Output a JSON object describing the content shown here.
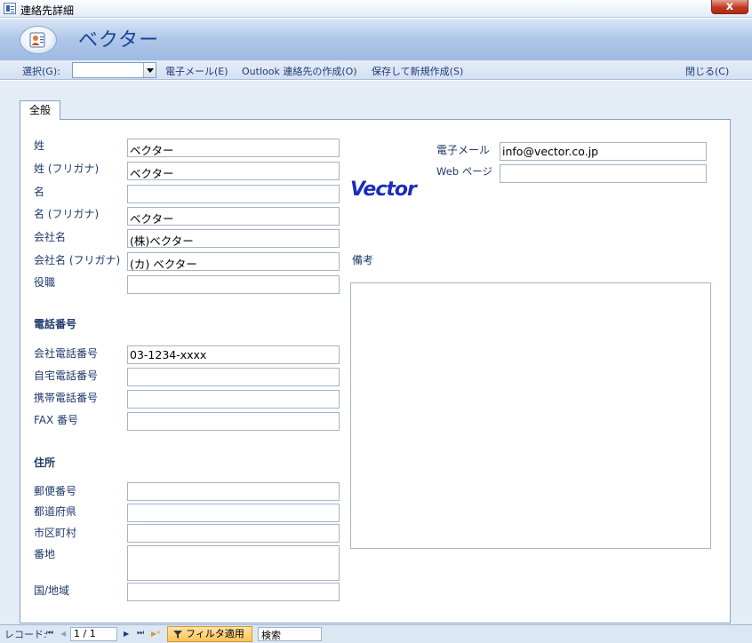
{
  "window": {
    "title": "連絡先詳細",
    "close_label": "x"
  },
  "header": {
    "form_title": "ベクター"
  },
  "toolbar": {
    "select_label": "選択(G):",
    "select_value": "",
    "email": "電子メール(E)",
    "outlook": "Outlook 連絡先の作成(O)",
    "save_new": "保存して新規作成(S)",
    "close": "閉じる(C)"
  },
  "tab": {
    "general": "全般"
  },
  "fields": {
    "last_name": {
      "label": "姓",
      "value": "ベクター"
    },
    "last_name_kana": {
      "label": "姓 (フリガナ)",
      "value": "ベクター"
    },
    "first_name": {
      "label": "名",
      "value": ""
    },
    "first_name_kana": {
      "label": "名 (フリガナ)",
      "value": "ベクター"
    },
    "company": {
      "label": "会社名",
      "value": "(株)ベクター"
    },
    "company_kana": {
      "label": "会社名 (フリガナ)",
      "value": "(カ) ベクター"
    },
    "job_title": {
      "label": "役職",
      "value": ""
    },
    "email": {
      "label": "電子メール",
      "value": "info@vector.co.jp"
    },
    "web": {
      "label": "Web ページ",
      "value": ""
    }
  },
  "phone": {
    "heading": "電話番号",
    "business": {
      "label": "会社電話番号",
      "value": "03-1234-xxxx"
    },
    "home": {
      "label": "自宅電話番号",
      "value": ""
    },
    "mobile": {
      "label": "携帯電話番号",
      "value": ""
    },
    "fax": {
      "label": "FAX 番号",
      "value": ""
    }
  },
  "address": {
    "heading": "住所",
    "postal": {
      "label": "郵便番号",
      "value": ""
    },
    "prefecture": {
      "label": "都道府県",
      "value": ""
    },
    "city": {
      "label": "市区町村",
      "value": ""
    },
    "street": {
      "label": "番地",
      "value": ""
    },
    "country": {
      "label": "国/地域",
      "value": ""
    }
  },
  "notes": {
    "label": "備考",
    "value": ""
  },
  "logo_text": "Vector",
  "statusbar": {
    "record_label": "レコード:",
    "first": "⏮",
    "prev": "◀",
    "position": "1 / 1",
    "next": "▶",
    "last": "⏭",
    "new": "▶*",
    "filter": "フィルタ適用",
    "search": "検索"
  },
  "colors": {
    "accent": "#16479a",
    "filter": "#ffc25a",
    "banner": "#aec6e8"
  }
}
